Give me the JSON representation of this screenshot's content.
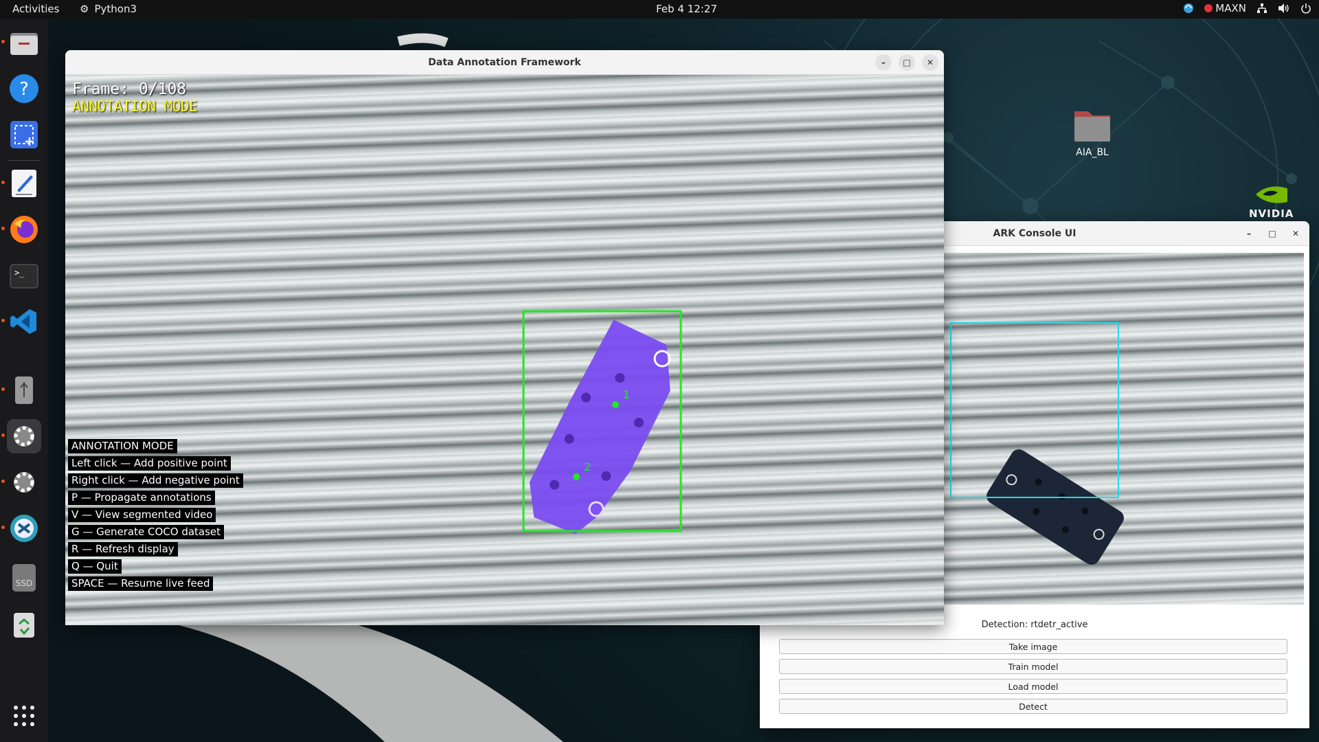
{
  "topbar": {
    "activities": "Activities",
    "app_name": "Python3",
    "clock": "Feb 4  12:27",
    "power_mode": "MAXN"
  },
  "dock": {
    "items": [
      {
        "name": "files-icon"
      },
      {
        "name": "help-icon"
      },
      {
        "name": "screenshot-icon"
      },
      {
        "name": "text-editor-icon"
      },
      {
        "name": "firefox-icon"
      },
      {
        "name": "terminal-icon"
      },
      {
        "name": "vscode-icon"
      },
      {
        "name": "usb-drive-icon"
      },
      {
        "name": "settings-icon"
      },
      {
        "name": "settings-icon-2"
      },
      {
        "name": "sync-app-icon"
      },
      {
        "name": "ssd-drive-icon"
      },
      {
        "name": "trash-icon"
      }
    ],
    "ssd_label": "SSD",
    "show_apps": "show-apps-icon"
  },
  "desktop": {
    "folder_label": "AIA_BL",
    "brand": "NVIDIA"
  },
  "annotation_window": {
    "title": "Data Annotation Framework",
    "frame_label": "Frame: 0/108",
    "mode_label": "ANNOTATION MODE",
    "point_labels": [
      "1",
      "2"
    ],
    "help_lines": [
      "ANNOTATION MODE",
      "Left click — Add positive point",
      "Right click — Add negative point",
      "P — Propagate annotations",
      "V — View segmented video",
      "G — Generate COCO dataset",
      "R — Refresh display",
      "Q — Quit",
      "SPACE — Resume live feed"
    ],
    "bbox_color": "#22e822",
    "mask_color": "#7a4cf0"
  },
  "ark_window": {
    "title": "ARK Console UI",
    "detection_status": "Detection: rtdetr_active",
    "buttons": [
      "Take image",
      "Train model",
      "Load model",
      "Detect"
    ],
    "bbox_color": "#22d8e8"
  }
}
